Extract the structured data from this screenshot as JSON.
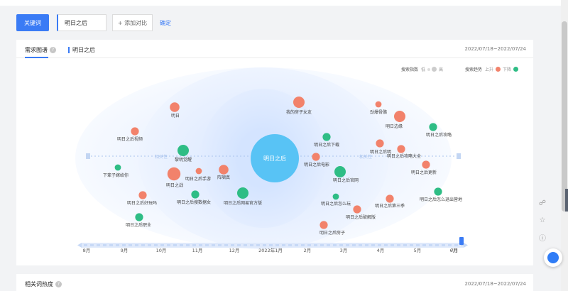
{
  "search": {
    "keyword_button": "关键词",
    "keyword_value": "明日之后",
    "add_compare": "+ 添加对比",
    "confirm": "确定"
  },
  "demand_card": {
    "tab_label": "需求图谱",
    "keyword_tag": "明日之后",
    "date_range": "2022/07/18~2022/07/24",
    "legend": {
      "index_label": "搜索指数",
      "low": "低",
      "high": "高",
      "trend_label": "搜索趋势",
      "up": "上升",
      "down": "下降",
      "up_color": "#f2826b",
      "down_color": "#2ebd85"
    },
    "center_word": "明日之后",
    "ring_labels": {
      "left": "相关性",
      "right": "相关性"
    },
    "nodes": [
      {
        "label": "明日",
        "trend": "up",
        "size": 4
      },
      {
        "label": "我的房子女友",
        "trend": "up",
        "size": 5
      },
      {
        "label": "劲爆骨骼",
        "trend": "up",
        "size": 2
      },
      {
        "label": "明日边缘",
        "trend": "up",
        "size": 5
      },
      {
        "label": "明日之后攻略",
        "trend": "down",
        "size": 3
      },
      {
        "label": "明日之后视频",
        "trend": "up",
        "size": 3
      },
      {
        "label": "明日之后下载",
        "trend": "down",
        "size": 3
      },
      {
        "label": "明日之后明",
        "trend": "up",
        "size": 3
      },
      {
        "label": "明日之后攻略大全",
        "trend": "up",
        "size": 3
      },
      {
        "label": "黎明觉醒",
        "trend": "down",
        "size": 5
      },
      {
        "label": "下辈子嫁给你",
        "trend": "down",
        "size": 2
      },
      {
        "label": "明日之战",
        "trend": "up",
        "size": 6
      },
      {
        "label": "明日之后手游",
        "trend": "up",
        "size": 2
      },
      {
        "label": "阵啸真",
        "trend": "up",
        "size": 4
      },
      {
        "label": "明日之后电影",
        "trend": "up",
        "size": 3
      },
      {
        "label": "明日之后官网",
        "trend": "down",
        "size": 5
      },
      {
        "label": "明日之后更新",
        "trend": "up",
        "size": 3
      },
      {
        "label": "明日之后好玩吗",
        "trend": "up",
        "size": 3
      },
      {
        "label": "明日之后搜数据女",
        "trend": "down",
        "size": 3
      },
      {
        "label": "明日之后网易官方版",
        "trend": "down",
        "size": 5
      },
      {
        "label": "明日之后怎么玩",
        "trend": "down",
        "size": 2
      },
      {
        "label": "明日之后第三季",
        "trend": "up",
        "size": 3
      },
      {
        "label": "明日之后怎么退出营地",
        "trend": "down",
        "size": 3
      },
      {
        "label": "明日之后破解版",
        "trend": "up",
        "size": 3
      },
      {
        "label": "明日之后职业",
        "trend": "down",
        "size": 3
      },
      {
        "label": "明日之后房子",
        "trend": "up",
        "size": 3
      }
    ],
    "timeline": [
      "8月",
      "9月",
      "10月",
      "11月",
      "12月",
      "2022年1月",
      "2月",
      "3月",
      "4月",
      "5月",
      "6月",
      "7月"
    ]
  },
  "hot_card": {
    "title": "相关词热度",
    "date_range": "2022/07/18~2022/07/24"
  }
}
